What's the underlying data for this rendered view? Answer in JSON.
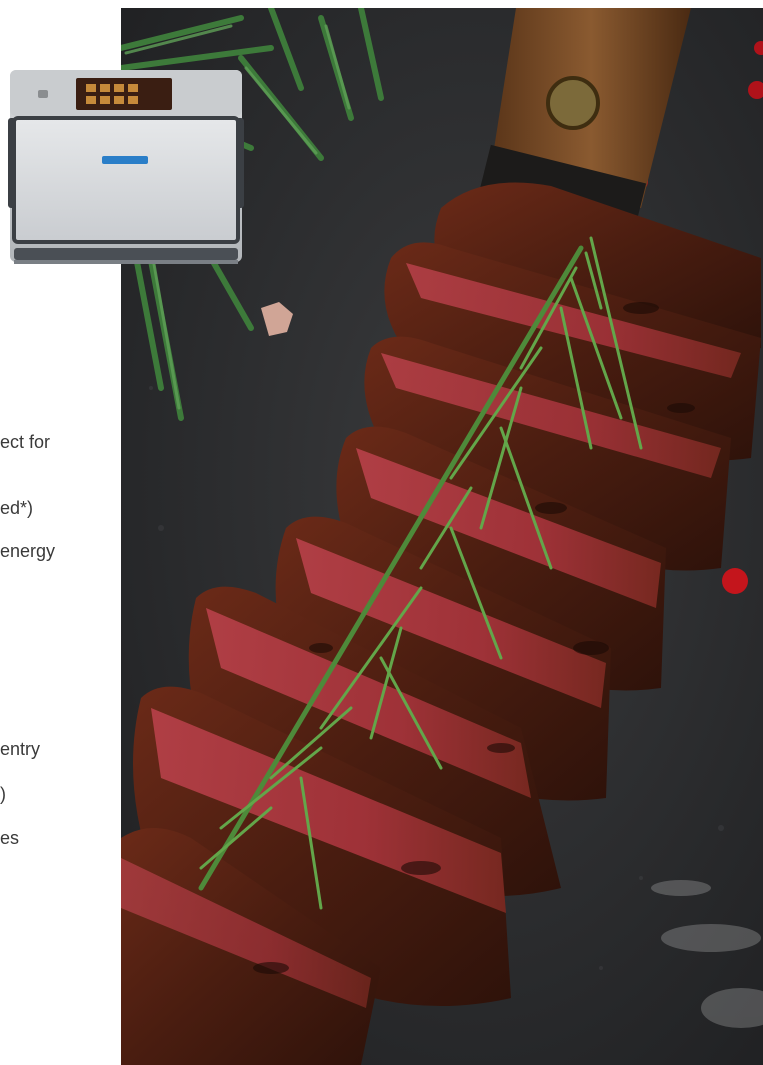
{
  "text_fragments": [
    "ect for",
    "ed*)",
    " energy",
    "entry",
    ")",
    "es"
  ],
  "oven": {
    "brand_plate_icon": "brand-plate-icon",
    "screen_icon": "touchscreen-icon"
  },
  "photo": {
    "subject": "sliced-steak-with-rosemary",
    "background_color": "#2b2c2e"
  }
}
